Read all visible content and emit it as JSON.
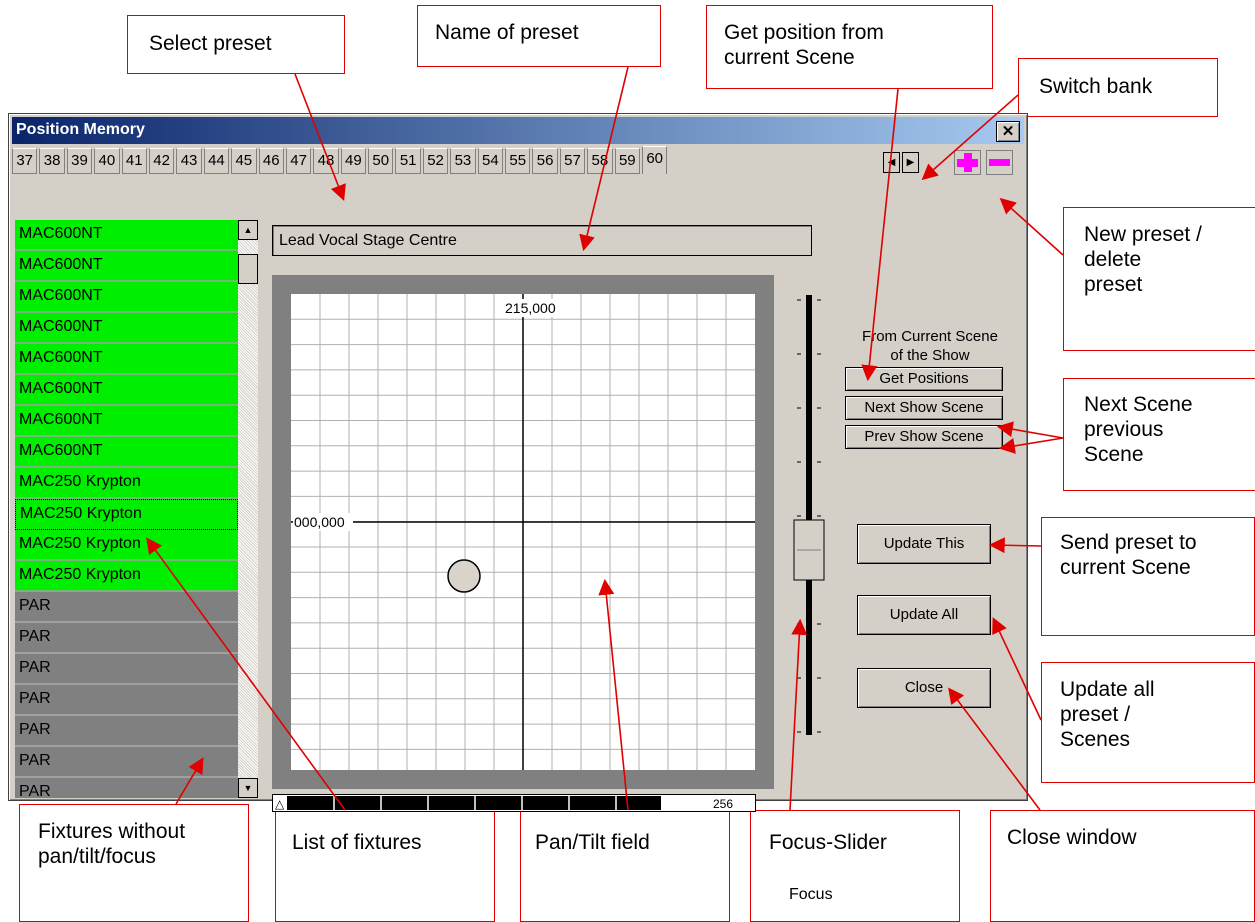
{
  "window": {
    "title": "Position Memory",
    "close_glyph": "✕"
  },
  "tabs": {
    "labels": [
      "37",
      "38",
      "39",
      "40",
      "41",
      "42",
      "43",
      "44",
      "45",
      "46",
      "47",
      "48",
      "49",
      "50",
      "51",
      "52",
      "53",
      "54",
      "55",
      "56",
      "57",
      "58",
      "59",
      "60"
    ],
    "selected": "60",
    "prev_glyph": "◀",
    "next_glyph": "▶",
    "new_icon": "plus-icon",
    "delete_icon": "minus-icon"
  },
  "fixtures": [
    {
      "label": "MAC600NT",
      "state": "green"
    },
    {
      "label": "MAC600NT",
      "state": "green"
    },
    {
      "label": "MAC600NT",
      "state": "green"
    },
    {
      "label": "MAC600NT",
      "state": "green"
    },
    {
      "label": "MAC600NT",
      "state": "green"
    },
    {
      "label": "MAC600NT",
      "state": "green"
    },
    {
      "label": "MAC600NT",
      "state": "green"
    },
    {
      "label": "MAC600NT",
      "state": "green"
    },
    {
      "label": "MAC250 Krypton",
      "state": "green"
    },
    {
      "label": "MAC250 Krypton",
      "state": "green"
    },
    {
      "label": "MAC250 Krypton",
      "state": "green"
    },
    {
      "label": "MAC250 Krypton",
      "state": "green"
    },
    {
      "label": "PAR",
      "state": "gray"
    },
    {
      "label": "PAR",
      "state": "gray"
    },
    {
      "label": "PAR",
      "state": "gray"
    },
    {
      "label": "PAR",
      "state": "gray"
    },
    {
      "label": "PAR",
      "state": "gray"
    },
    {
      "label": "PAR",
      "state": "gray"
    },
    {
      "label": "PAR",
      "state": "gray"
    }
  ],
  "preset_name": "Lead Vocal Stage Centre",
  "pan_tilt": {
    "top_label": "215,000",
    "left_label": "000,000",
    "colors": {
      "grid": "#b0b0b0",
      "axis": "#000000",
      "frame": "#808080"
    }
  },
  "focus_bar": {
    "value": "256",
    "marker": "△"
  },
  "focus_label": "Focus",
  "scene_panel": {
    "from_label_line1": "From Current Scene",
    "from_label_line2": "of the Show",
    "get_positions": "Get Positions",
    "next_show_scene": "Next Show Scene",
    "prev_show_scene": "Prev Show Scene"
  },
  "buttons": {
    "update_this": "Update This",
    "update_all": "Update All",
    "close": "Close"
  },
  "callouts": {
    "select_preset": "Select preset",
    "name_of_preset": "Name of preset",
    "get_position_1": "Get position from",
    "get_position_2": "current Scene",
    "switch_bank": "Switch bank",
    "new_preset_1": "New preset /",
    "new_preset_2": "delete",
    "new_preset_3": "preset",
    "next_scene_1": "Next Scene",
    "next_scene_2": "previous",
    "next_scene_3": "Scene",
    "send_preset_1": "Send preset to",
    "send_preset_2": "current Scene",
    "update_all_1": "Update all",
    "update_all_2": "preset /",
    "update_all_3": "Scenes",
    "close_window": "Close window",
    "fixtures_without_1": "Fixtures without",
    "fixtures_without_2": "pan/tilt/focus",
    "list_of_fixtures": "List of fixtures",
    "pan_tilt_field": "Pan/Tilt field",
    "focus_slider": "Focus-Slider"
  },
  "colors": {
    "fixture_active": "#00ee00",
    "fixture_inactive": "#808080",
    "window_bg": "#d4d0c8",
    "callout_border": "#e00000",
    "arrow": "#e00000",
    "plus": "#ff00ff",
    "minus": "#ff00ff"
  }
}
